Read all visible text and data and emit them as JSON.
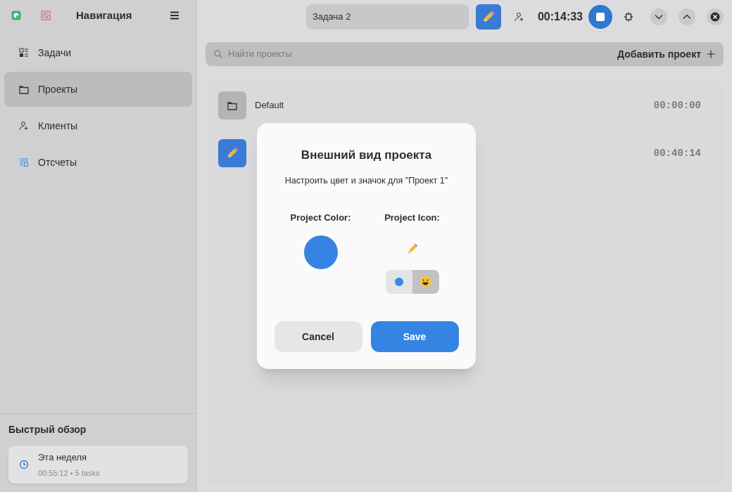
{
  "sidebar": {
    "title": "Навигация",
    "items": [
      {
        "label": "Задачи",
        "kind": "tasks",
        "selected": false
      },
      {
        "label": "Проекты",
        "kind": "folder",
        "selected": true
      },
      {
        "label": "Клиенты",
        "kind": "clients",
        "selected": false
      },
      {
        "label": "Отсчеты",
        "kind": "report",
        "selected": false
      }
    ],
    "overview": {
      "title": "Быстрый обзор",
      "card": {
        "title": "Эта неделя",
        "meta": "00:55:12 • 5 tasks"
      }
    }
  },
  "header": {
    "task": "Задача 2",
    "timer": "00:14:33"
  },
  "search": {
    "placeholder": "Найти проекты",
    "add_label": "Добавить проект"
  },
  "projects": [
    {
      "name": "Default",
      "time": "00:00:00",
      "kind": "folder",
      "color": "#b4b4b6"
    },
    {
      "time": "00:40:14",
      "kind": "pencil",
      "color": "#3a7bd5"
    }
  ],
  "dialog": {
    "title": "Внешний вид проекта",
    "subtitle": "Настроить цвет и значок для \"Проект 1\"",
    "color_label": "Project Color:",
    "icon_label": "Project Icon:",
    "color": "#3584e4",
    "icon_modes": [
      {
        "kind": "color",
        "selected": false
      },
      {
        "kind": "emoji",
        "selected": true
      }
    ],
    "buttons": [
      {
        "label": "Cancel",
        "kind": "secondary"
      },
      {
        "label": "Save",
        "kind": "primary"
      }
    ]
  }
}
